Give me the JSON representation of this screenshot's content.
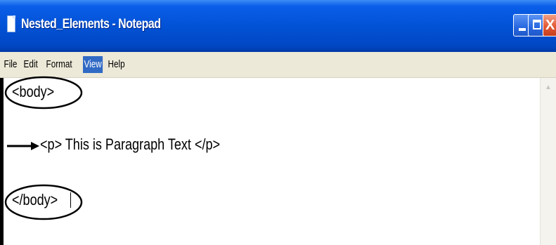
{
  "window": {
    "title": "Nested_Elements - Notepad",
    "icon": "notepad-icon"
  },
  "title_buttons": [
    {
      "name": "minimize-button",
      "icon": "minimize-icon"
    },
    {
      "name": "maximize-button",
      "icon": "maximize-icon"
    },
    {
      "name": "close-button",
      "icon": "close-icon",
      "glyph": "X"
    }
  ],
  "menu": {
    "items": [
      "File",
      "Edit",
      "Format",
      "View",
      "Help"
    ],
    "active": "View",
    "active_color": "#316ac5"
  },
  "editor": {
    "lines": [
      "<body>",
      "<p> This is Paragraph Text </p>",
      "</body>"
    ],
    "annotations": {
      "circles": "body-tags",
      "arrow": "indent-arrow"
    }
  },
  "colors": {
    "titlebar": "#0252d6",
    "menubar": "#ece9d8",
    "close_button": "#e35936"
  }
}
